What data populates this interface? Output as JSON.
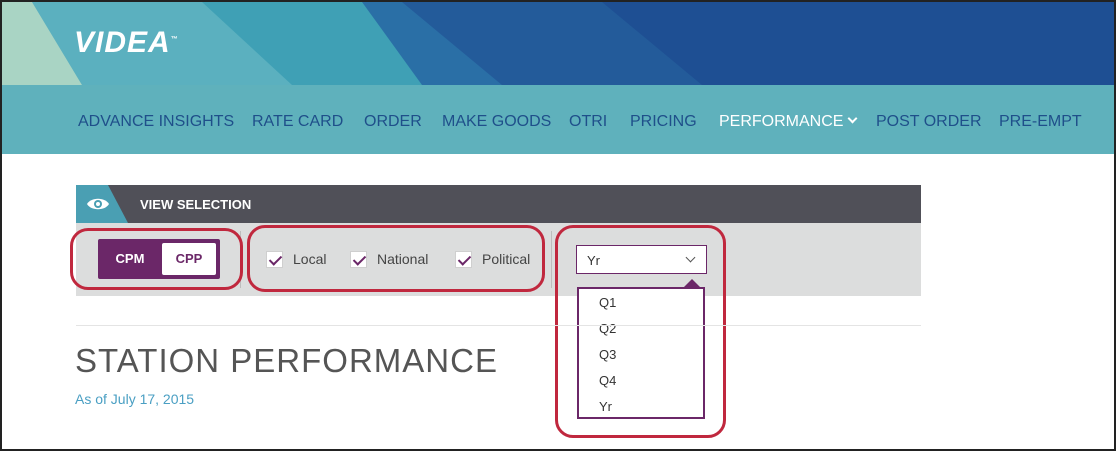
{
  "header": {
    "logo": "VIDEA",
    "logo_tm": "™"
  },
  "nav": {
    "items": [
      {
        "label": "ADVANCE INSIGHTS"
      },
      {
        "label": "RATE CARD"
      },
      {
        "label": "ORDER"
      },
      {
        "label": "MAKE GOODS"
      },
      {
        "label": "OTRI"
      },
      {
        "label": "PRICING"
      },
      {
        "label": "PERFORMANCE",
        "active": true,
        "icon": "chevron-down-icon"
      },
      {
        "label": "POST ORDER"
      },
      {
        "label": "PRE-EMPT"
      }
    ]
  },
  "view_selection": {
    "title": "VIEW SELECTION",
    "icon": "eye-icon",
    "metric_toggle": {
      "options": [
        "CPM",
        "CPP"
      ],
      "selected": "CPP"
    },
    "filters": [
      {
        "label": "Local",
        "checked": true
      },
      {
        "label": "National",
        "checked": true
      },
      {
        "label": "Political",
        "checked": true
      }
    ],
    "period_select": {
      "value": "Yr",
      "options": [
        "Q1",
        "Q2",
        "Q3",
        "Q4",
        "Yr"
      ]
    }
  },
  "page": {
    "title": "STATION PERFORMANCE",
    "as_of": "As of July 17, 2015"
  },
  "colors": {
    "accent": "#6b2768",
    "nav_bg": "#5fb1bc",
    "highlight": "#c0283e",
    "panel_bar": "#505058"
  }
}
